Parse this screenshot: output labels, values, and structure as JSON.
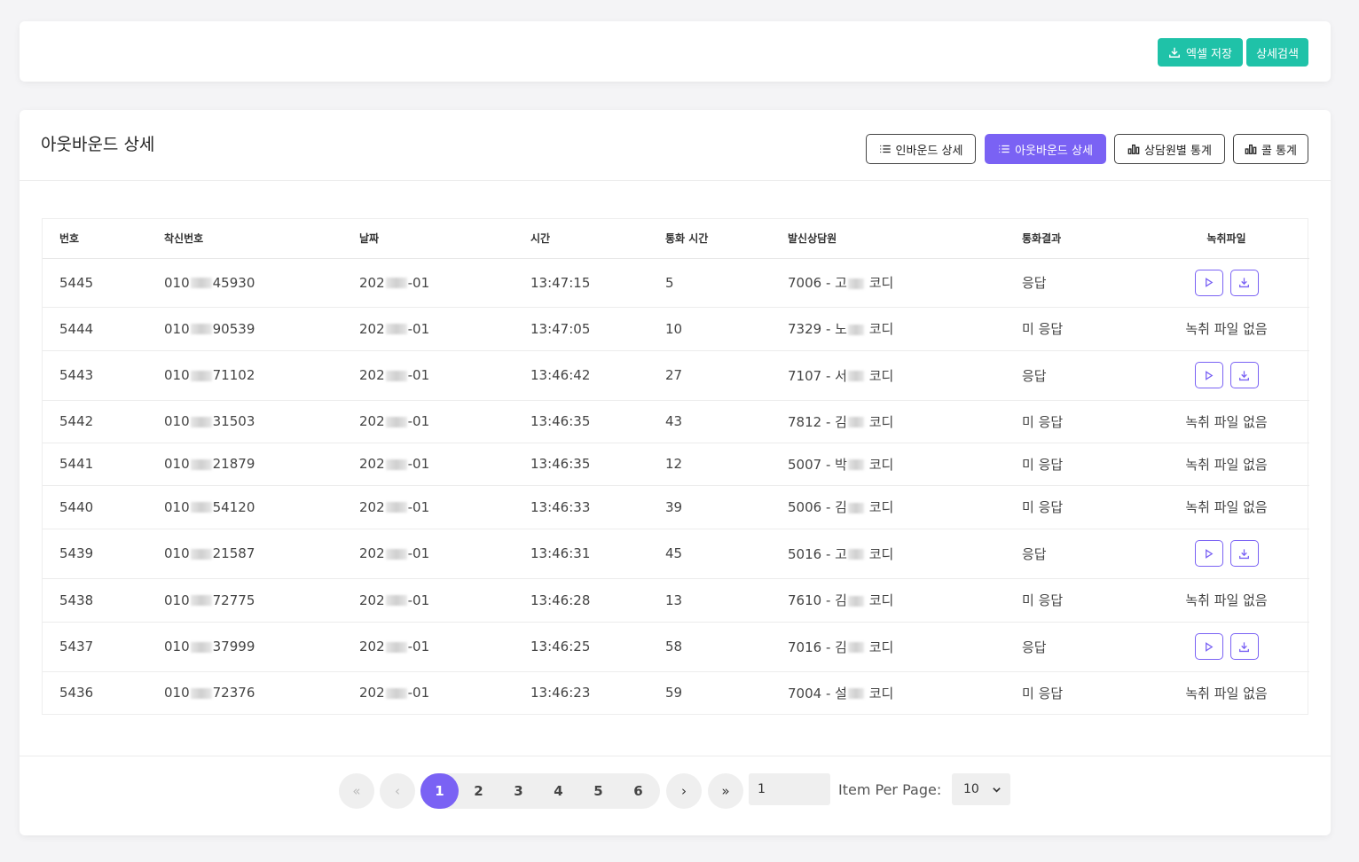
{
  "toolbar": {
    "excel_label": "엑셀 저장",
    "search_label": "상세검색"
  },
  "header": {
    "title": "아웃바운드 상세",
    "tabs": [
      {
        "label": "인바운드 상세",
        "icon": "list-icon",
        "active": false
      },
      {
        "label": "아웃바운드 상세",
        "icon": "list-icon",
        "active": true
      },
      {
        "label": "상담원별 통계",
        "icon": "bar-chart-icon",
        "active": false
      },
      {
        "label": "콜 통계",
        "icon": "bar-chart-icon",
        "active": false
      }
    ]
  },
  "table": {
    "columns": [
      "번호",
      "착신번호",
      "날짜",
      "시간",
      "통화 시간",
      "발신상담원",
      "통화결과",
      "녹취파일"
    ],
    "rows": [
      {
        "no": "5445",
        "phone_prefix": "010",
        "phone_suffix": "45930",
        "date_prefix": "202",
        "date_suffix": "-01",
        "time": "13:47:15",
        "duration": "5",
        "agent_prefix": "7006 - 고",
        "agent_suffix": "코디",
        "result": "응답",
        "has_file": true
      },
      {
        "no": "5444",
        "phone_prefix": "010",
        "phone_suffix": "90539",
        "date_prefix": "202",
        "date_suffix": "-01",
        "time": "13:47:05",
        "duration": "10",
        "agent_prefix": "7329 - 노",
        "agent_suffix": "코디",
        "result": "미 응답",
        "has_file": false
      },
      {
        "no": "5443",
        "phone_prefix": "010",
        "phone_suffix": "71102",
        "date_prefix": "202",
        "date_suffix": "-01",
        "time": "13:46:42",
        "duration": "27",
        "agent_prefix": "7107 - 서",
        "agent_suffix": "코디",
        "result": "응답",
        "has_file": true
      },
      {
        "no": "5442",
        "phone_prefix": "010",
        "phone_suffix": "31503",
        "date_prefix": "202",
        "date_suffix": "-01",
        "time": "13:46:35",
        "duration": "43",
        "agent_prefix": "7812 - 김",
        "agent_suffix": "코디",
        "result": "미 응답",
        "has_file": false
      },
      {
        "no": "5441",
        "phone_prefix": "010",
        "phone_suffix": "21879",
        "date_prefix": "202",
        "date_suffix": "-01",
        "time": "13:46:35",
        "duration": "12",
        "agent_prefix": "5007 - 박",
        "agent_suffix": "코디",
        "result": "미 응답",
        "has_file": false
      },
      {
        "no": "5440",
        "phone_prefix": "010",
        "phone_suffix": "54120",
        "date_prefix": "202",
        "date_suffix": "-01",
        "time": "13:46:33",
        "duration": "39",
        "agent_prefix": "5006 - 김",
        "agent_suffix": "코디",
        "result": "미 응답",
        "has_file": false
      },
      {
        "no": "5439",
        "phone_prefix": "010",
        "phone_suffix": "21587",
        "date_prefix": "202",
        "date_suffix": "-01",
        "time": "13:46:31",
        "duration": "45",
        "agent_prefix": "5016 - 고",
        "agent_suffix": "코디",
        "result": "응답",
        "has_file": true
      },
      {
        "no": "5438",
        "phone_prefix": "010",
        "phone_suffix": "72775",
        "date_prefix": "202",
        "date_suffix": "-01",
        "time": "13:46:28",
        "duration": "13",
        "agent_prefix": "7610 - 김",
        "agent_suffix": "코디",
        "result": "미 응답",
        "has_file": false
      },
      {
        "no": "5437",
        "phone_prefix": "010",
        "phone_suffix": "37999",
        "date_prefix": "202",
        "date_suffix": "-01",
        "time": "13:46:25",
        "duration": "58",
        "agent_prefix": "7016 - 김",
        "agent_suffix": "코디",
        "result": "응답",
        "has_file": true
      },
      {
        "no": "5436",
        "phone_prefix": "010",
        "phone_suffix": "72376",
        "date_prefix": "202",
        "date_suffix": "-01",
        "time": "13:46:23",
        "duration": "59",
        "agent_prefix": "7004 - 설",
        "agent_suffix": "코디",
        "result": "미 응답",
        "has_file": false
      }
    ],
    "no_file_label": "녹취 파일 없음"
  },
  "pagination": {
    "pages": [
      "1",
      "2",
      "3",
      "4",
      "5",
      "6"
    ],
    "current": "1",
    "first_glyph": "«",
    "prev_glyph": "‹",
    "next_glyph": "›",
    "last_glyph": "»",
    "page_input_value": "1",
    "item_per_page_label": "Item Per Page:",
    "item_per_page_value": "10"
  },
  "colors": {
    "accent": "#7a62f4",
    "teal": "#1fc2a8"
  }
}
